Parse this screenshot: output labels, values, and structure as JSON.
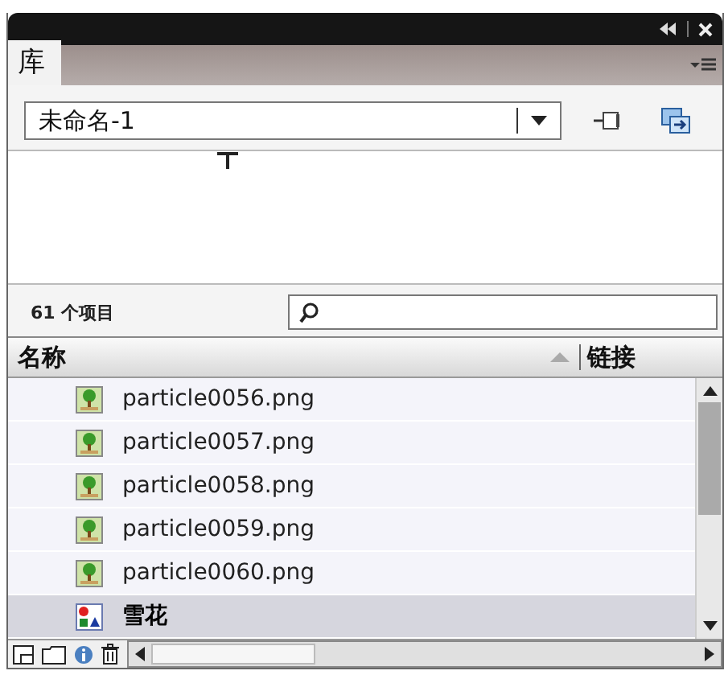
{
  "tabs": [
    {
      "label": "库",
      "selected": true
    }
  ],
  "library_select": {
    "value": "未命名-1"
  },
  "item_count": "61 个项目",
  "columns": [
    "名称",
    "链接"
  ],
  "rows": [
    {
      "name": "particle0056.png",
      "kind": "bitmap",
      "selected": false
    },
    {
      "name": "particle0057.png",
      "kind": "bitmap",
      "selected": false
    },
    {
      "name": "particle0058.png",
      "kind": "bitmap",
      "selected": false
    },
    {
      "name": "particle0059.png",
      "kind": "bitmap",
      "selected": false
    },
    {
      "name": "particle0060.png",
      "kind": "bitmap",
      "selected": false
    },
    {
      "name": "雪花",
      "kind": "symbol",
      "selected": true
    }
  ]
}
